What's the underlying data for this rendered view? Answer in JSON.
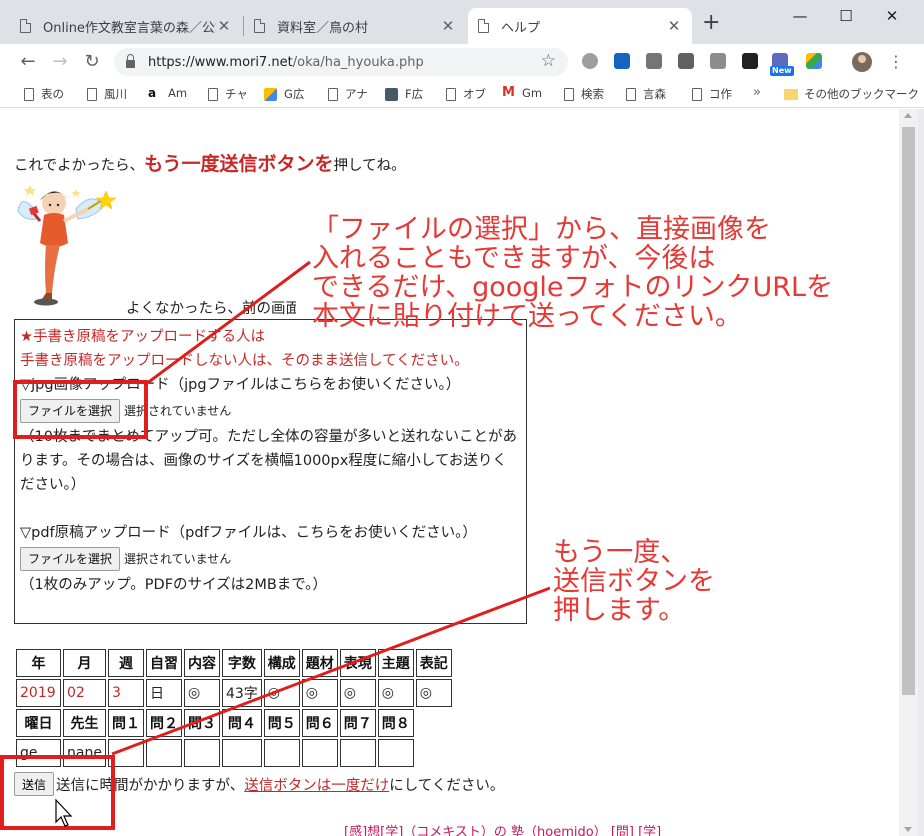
{
  "browser": {
    "tabs": [
      {
        "title": "Online作文教室言葉の森／公式",
        "active": false
      },
      {
        "title": "資料室／鳥の村",
        "active": false
      },
      {
        "title": "ヘルプ",
        "active": true
      }
    ],
    "new_tab": "+",
    "window": {
      "minimize": "—",
      "maximize": "☐",
      "close": "✕"
    },
    "url_main": "https://www.mori7.net",
    "url_path": "/oka/ha_hyouka.php",
    "ext_new_badge": "New",
    "bookmarks": [
      "表の",
      "風川",
      "Am",
      "チャ",
      "G広",
      "アナ",
      "F広",
      "オブ",
      "Gm",
      "検索",
      "言森",
      "コ作"
    ],
    "bookmarks_more": "»",
    "other_bookmarks": "その他のブックマーク"
  },
  "page": {
    "prompt_pre": "これでよかったら、",
    "prompt_emph": "もう一度送信ボタンを",
    "prompt_post": "押してね。",
    "not_good": "よくなかったら、前の画面に戻ってね。",
    "upload": {
      "red_line1": "★手書き原稿をアップロードする人は",
      "red_line2": "手書き原稿をアップロードしない人は、そのまま送信してください。",
      "jpg_label": "▽jpg画像アップロード（jpgファイルはこちらをお使いください。）",
      "file_button": "ファイルを選択",
      "no_file": "選択されていません",
      "jpg_note": "（10枚までまとめてアップ可。ただし全体の容量が多いと送れないことがあります。その場合は、画像のサイズを横幅1000px程度に縮小してお送りください。）",
      "pdf_label": "▽pdf原稿アップロード（pdfファイルは、こちらをお使いください。）",
      "pdf_note": "（1枚のみアップ。PDFのサイズは2MBまで。）"
    },
    "grade_table": {
      "header1": [
        "年",
        "月",
        "週",
        "自習",
        "内容",
        "字数",
        "構成",
        "題材",
        "表現",
        "主題",
        "表記"
      ],
      "row1": [
        "2019",
        "02",
        "3",
        "日",
        "◎",
        "43字",
        "◎",
        "◎",
        "◎",
        "◎",
        "◎"
      ],
      "header2": [
        "曜日",
        "先生",
        "問１",
        "問２",
        "問３",
        "問４",
        "問５",
        "問６",
        "問７",
        "問８"
      ],
      "row2": [
        "ge",
        "nane",
        "",
        "",
        "",
        "",
        "",
        "",
        "",
        ""
      ]
    },
    "send_button": "送信",
    "send_pre": "送信に時間がかかりますが、",
    "send_link": "送信ボタンは一度だけ",
    "send_post": "にしてください。",
    "cutoff_text": "[感]想[学]（コメキスト）の 塾（hoemido） [問] [学]"
  },
  "annotations": {
    "note1": [
      "「ファイルの選択」から、直接画像を",
      "入れることもできますが、今後は",
      "できるだけ、googleフォトのリンクURLを",
      "本文に貼り付けて送ってください。"
    ],
    "note2": [
      "もう一度、",
      "送信ボタンを",
      "押します。"
    ]
  },
  "colors": {
    "annotation_red": "#e01e1e",
    "page_red": "#c62828"
  }
}
